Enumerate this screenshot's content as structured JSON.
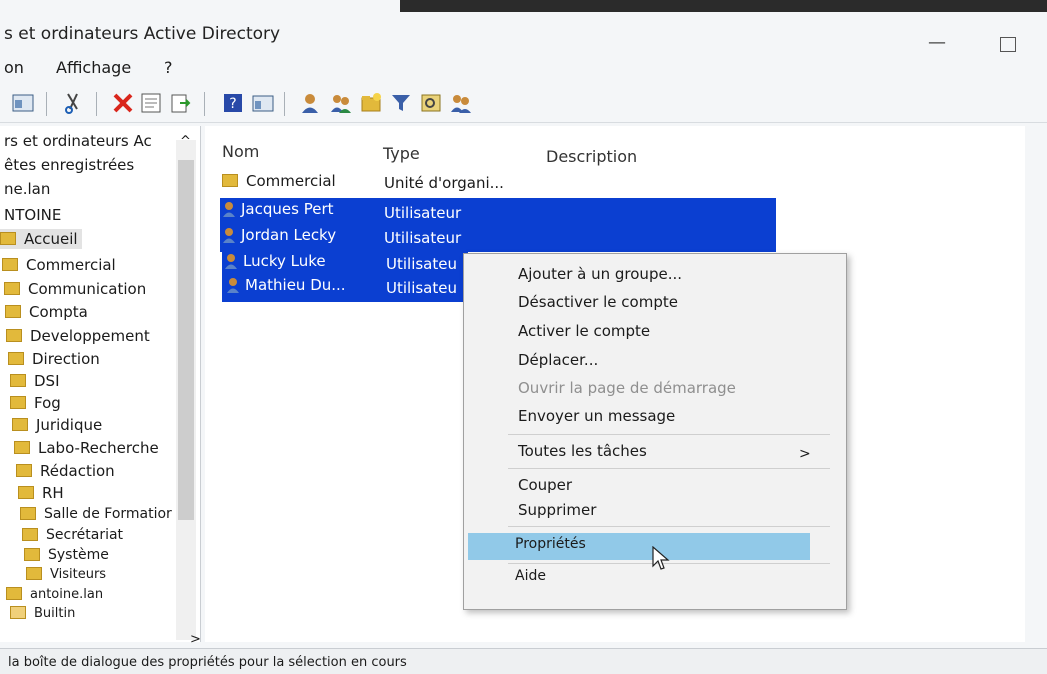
{
  "window": {
    "title": "s et ordinateurs Active Directory",
    "minimize_glyph": "—"
  },
  "menubar": {
    "items": [
      "on",
      "Affichage",
      "?"
    ]
  },
  "toolbar": {
    "icons": [
      "console-tree-icon",
      "cut-icon",
      "delete-icon",
      "properties-icon",
      "export-icon",
      "help-icon",
      "view-icon",
      "new-user-icon",
      "new-group-icon",
      "new-ou-icon",
      "filter-icon",
      "find-icon",
      "add-to-group-icon"
    ]
  },
  "tree": {
    "items": [
      {
        "label": "rs et ordinateurs Ac",
        "icon": "none"
      },
      {
        "label": "êtes enregistrées",
        "icon": "none"
      },
      {
        "label": "ne.lan",
        "icon": "none"
      },
      {
        "label": "NTOINE",
        "icon": "none"
      },
      {
        "label": "Accueil",
        "icon": "ou-folder-icon"
      },
      {
        "label": "Commercial",
        "icon": "ou-folder-icon"
      },
      {
        "label": "Communication",
        "icon": "ou-folder-icon"
      },
      {
        "label": "Compta",
        "icon": "ou-folder-icon"
      },
      {
        "label": "Developpement",
        "icon": "ou-folder-icon"
      },
      {
        "label": "Direction",
        "icon": "ou-folder-icon"
      },
      {
        "label": "DSI",
        "icon": "ou-folder-icon"
      },
      {
        "label": "Fog",
        "icon": "ou-folder-icon"
      },
      {
        "label": "Juridique",
        "icon": "ou-folder-icon"
      },
      {
        "label": "Labo-Recherche",
        "icon": "ou-folder-icon"
      },
      {
        "label": "Rédaction",
        "icon": "ou-folder-icon"
      },
      {
        "label": "RH",
        "icon": "ou-folder-icon"
      },
      {
        "label": "Salle de Formatior",
        "icon": "ou-folder-icon"
      },
      {
        "label": "Secrétariat",
        "icon": "ou-folder-icon"
      },
      {
        "label": "Système",
        "icon": "ou-folder-icon"
      },
      {
        "label": "Visiteurs",
        "icon": "ou-folder-icon"
      },
      {
        "label": "antoine.lan",
        "icon": "ou-folder-icon"
      },
      {
        "label": "Builtin",
        "icon": "folder-icon"
      }
    ],
    "selected": "Accueil"
  },
  "list": {
    "columns": [
      "Nom",
      "Type",
      "Description"
    ],
    "rows": [
      {
        "name": "Commercial",
        "type": "Unité d'organi...",
        "icon": "ou-folder-icon",
        "selected": false
      },
      {
        "name": "Jacques Pert",
        "type": "Utilisateur",
        "icon": "user-icon",
        "selected": true
      },
      {
        "name": "Jordan Lecky",
        "type": "Utilisateur",
        "icon": "user-icon",
        "selected": true
      },
      {
        "name": "Lucky Luke",
        "type": "Utilisateu",
        "icon": "user-icon",
        "selected": true
      },
      {
        "name": "Mathieu Du...",
        "type": "Utilisateu",
        "icon": "user-icon",
        "selected": true
      }
    ]
  },
  "context_menu": {
    "items": [
      {
        "label": "Ajouter à un groupe...",
        "disabled": false
      },
      {
        "label": "Désactiver le compte",
        "disabled": false
      },
      {
        "label": "Activer le compte",
        "disabled": false
      },
      {
        "label": "Déplacer...",
        "disabled": false
      },
      {
        "label": "Ouvrir la page de démarrage",
        "disabled": true
      },
      {
        "label": "Envoyer un message",
        "disabled": false
      },
      {
        "label": "Toutes les tâches",
        "disabled": false,
        "submenu": true
      },
      {
        "label": "Couper",
        "disabled": false
      },
      {
        "label": "Supprimer",
        "disabled": false
      },
      {
        "label": "Propriétés",
        "disabled": false,
        "highlighted": true
      },
      {
        "label": "Aide",
        "disabled": false
      }
    ],
    "submenu_arrow": ">"
  },
  "scroll": {
    "up": "^",
    "down": "v",
    "right": ">"
  },
  "status": {
    "text": "la boîte de dialogue des propriétés pour la sélection en cours"
  },
  "colors": {
    "selection": "#0b3fd1",
    "menu_highlight": "#91c9e8",
    "folder": "#e2b93b"
  }
}
